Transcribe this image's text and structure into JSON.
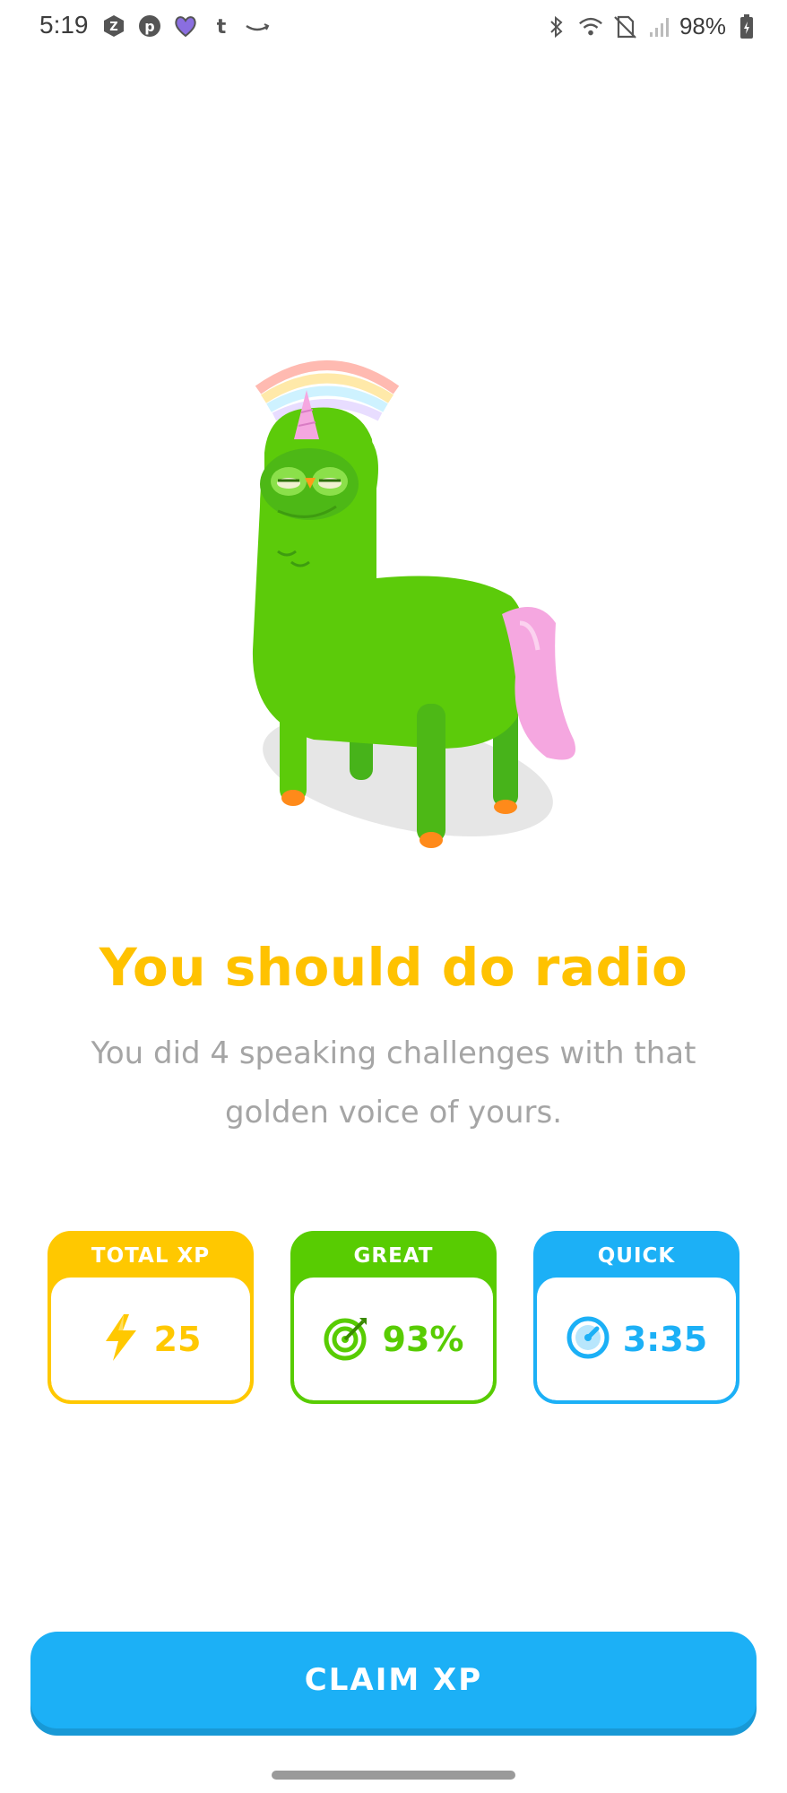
{
  "status_bar": {
    "time": "5:19",
    "battery": "98%",
    "left_icons": [
      "z-icon",
      "pinterest-icon",
      "heart-app-icon",
      "tumblr-icon",
      "amazon-icon"
    ],
    "right_icons": [
      "bluetooth-icon",
      "wifi-icon",
      "no-sim-icon",
      "signal-icon",
      "battery-icon"
    ]
  },
  "illustration": {
    "subject": "unicorn-owl-icon"
  },
  "headline": "You should do radio",
  "subtitle": "You did 4 speaking challenges with that golden voice of yours.",
  "stats": [
    {
      "label": "TOTAL XP",
      "value": "25",
      "icon": "lightning-icon",
      "color": "#ffc800"
    },
    {
      "label": "GREAT",
      "value": "93%",
      "icon": "target-icon",
      "color": "#58cc02"
    },
    {
      "label": "QUICK",
      "value": "3:35",
      "icon": "stopwatch-icon",
      "color": "#1cb0f6"
    }
  ],
  "claim_button": {
    "label": "CLAIM XP",
    "color": "#1cb0f6"
  }
}
